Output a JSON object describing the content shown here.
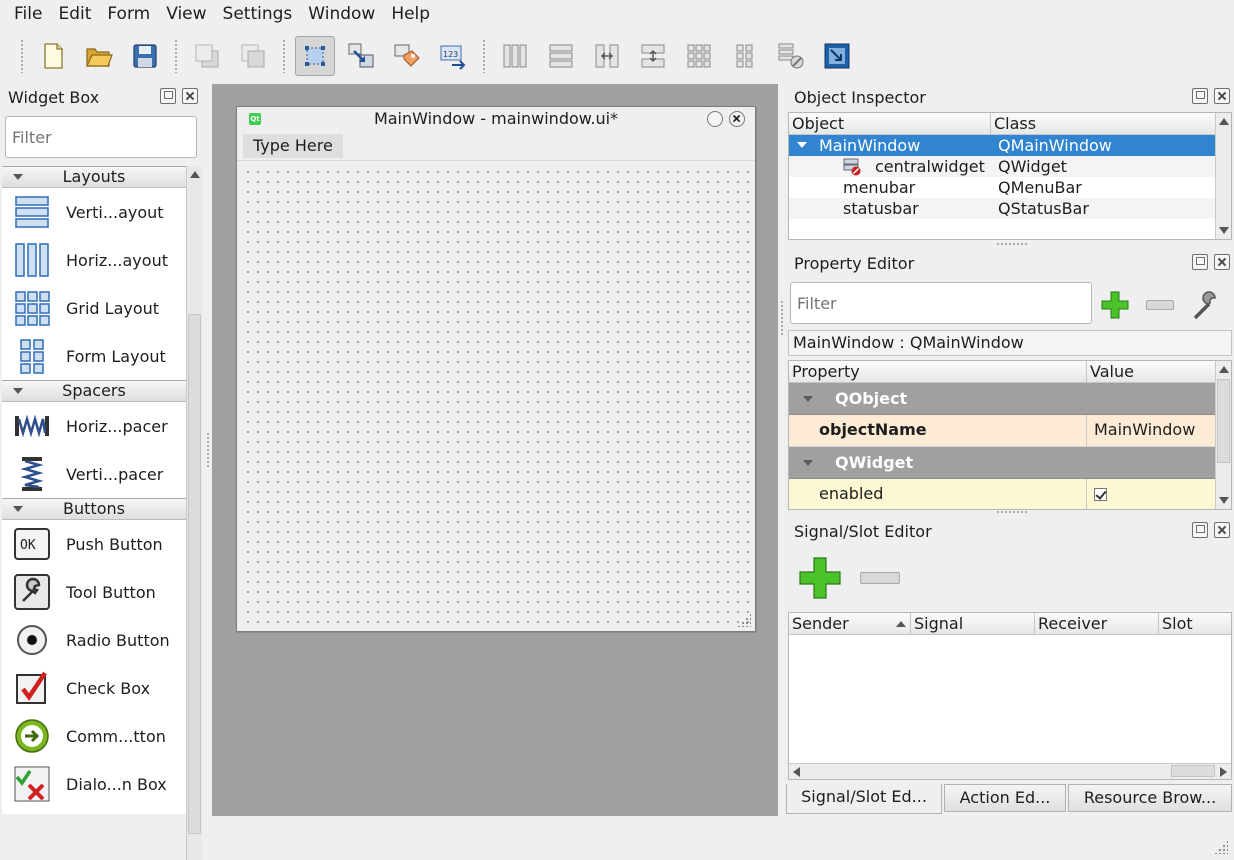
{
  "menubar": {
    "items": [
      "File",
      "Edit",
      "Form",
      "View",
      "Settings",
      "Window",
      "Help"
    ]
  },
  "toolbar": {
    "icons": [
      "new-file-icon",
      "open-folder-icon",
      "save-icon",
      "send-to-back-icon",
      "bring-to-front-icon",
      "edit-widgets-icon",
      "edit-signals-slots-icon",
      "edit-buddies-icon",
      "edit-tab-order-icon",
      "layout-horizontal-icon",
      "layout-vertical-icon",
      "layout-horizontal-splitter-icon",
      "layout-vertical-splitter-icon",
      "layout-grid-icon",
      "layout-form-icon",
      "break-layout-icon",
      "adjust-size-icon"
    ]
  },
  "widget_box": {
    "title": "Widget Box",
    "filter_placeholder": "Filter",
    "categories": [
      {
        "name": "Layouts",
        "items": [
          "Verti...ayout",
          "Horiz...ayout",
          "Grid Layout",
          "Form Layout"
        ]
      },
      {
        "name": "Spacers",
        "items": [
          "Horiz...pacer",
          "Verti...pacer"
        ]
      },
      {
        "name": "Buttons",
        "items": [
          "Push Button",
          "Tool Button",
          "Radio Button",
          "Check Box",
          "Comm...tton",
          "Dialo...n Box"
        ]
      }
    ]
  },
  "form": {
    "title": "MainWindow - mainwindow.ui*",
    "menu_placeholder": "Type Here"
  },
  "object_inspector": {
    "title": "Object Inspector",
    "columns": [
      "Object",
      "Class"
    ],
    "rows": [
      {
        "object": "MainWindow",
        "class": "QMainWindow"
      },
      {
        "object": "centralwidget",
        "class": "QWidget"
      },
      {
        "object": "menubar",
        "class": "QMenuBar"
      },
      {
        "object": "statusbar",
        "class": "QStatusBar"
      }
    ]
  },
  "property_editor": {
    "title": "Property Editor",
    "filter_placeholder": "Filter",
    "class_label": "MainWindow : QMainWindow",
    "columns": [
      "Property",
      "Value"
    ],
    "group1": "QObject",
    "row1": {
      "property": "objectName",
      "value": "MainWindow"
    },
    "group2": "QWidget",
    "row2": {
      "property": "enabled",
      "checked": true
    }
  },
  "signal_slot_editor": {
    "title": "Signal/Slot Editor",
    "columns": [
      "Sender",
      "Signal",
      "Receiver",
      "Slot"
    ]
  },
  "bottom_tabs": [
    "Signal/Slot Ed...",
    "Action Ed...",
    "Resource Brow..."
  ],
  "colors": {
    "selection": "#3084d0",
    "mdi_background": "#a0a0a0",
    "property_group": "#a0a0a0",
    "changed_property": "#fdebd6",
    "property_row": "#fdf8d4"
  }
}
